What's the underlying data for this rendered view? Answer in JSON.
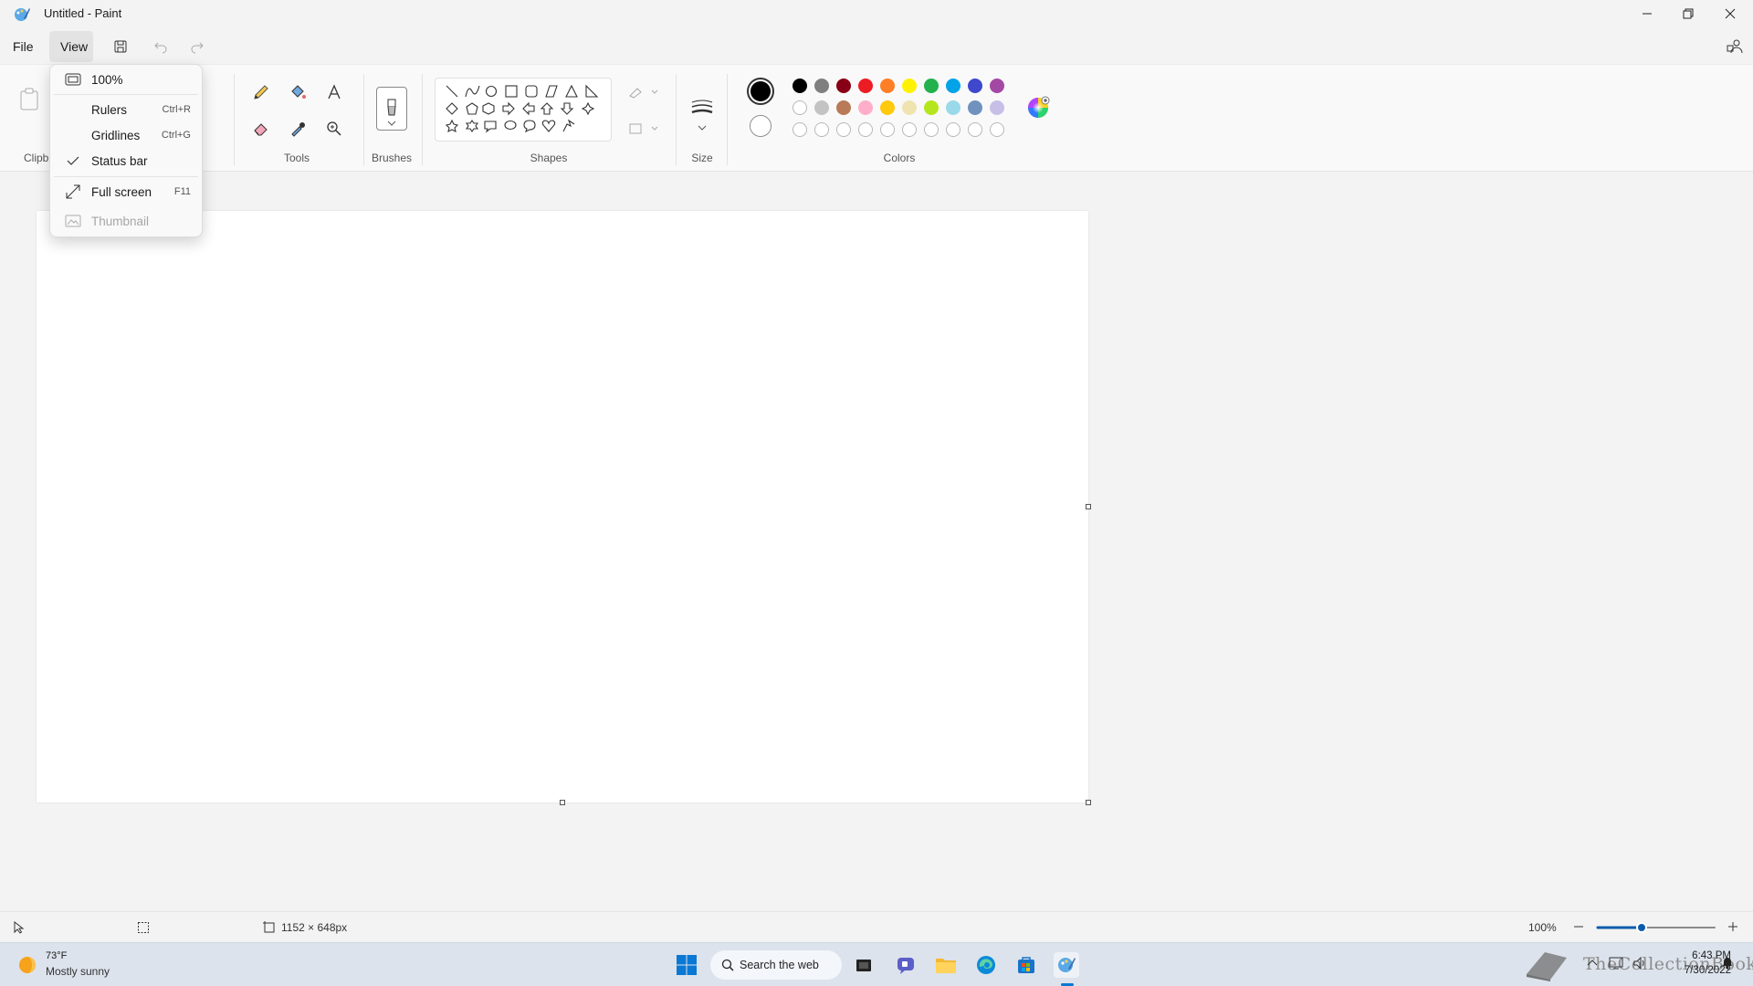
{
  "window": {
    "title": "Untitled - Paint"
  },
  "menu": {
    "file": "File",
    "view": "View"
  },
  "view_menu": {
    "zoom_label": "100%",
    "rulers": "Rulers",
    "rulers_shortcut": "Ctrl+R",
    "gridlines": "Gridlines",
    "gridlines_shortcut": "Ctrl+G",
    "status_bar": "Status bar",
    "status_bar_checked": true,
    "full_screen": "Full screen",
    "full_screen_shortcut": "F11",
    "thumbnail": "Thumbnail",
    "thumbnail_disabled": true
  },
  "ribbon": {
    "clipboard_partial": "Clipb",
    "tools": "Tools",
    "brushes": "Brushes",
    "shapes": "Shapes",
    "size": "Size",
    "colors": "Colors"
  },
  "palette": {
    "primary": "#000000",
    "secondary": "#ffffff",
    "row1": [
      "#000000",
      "#7f7f7f",
      "#880015",
      "#ed1c24",
      "#ff7f27",
      "#fff200",
      "#22b14c",
      "#00a2e8",
      "#3f48cc",
      "#a349a4"
    ],
    "row2": [
      "#ffffff",
      "#c3c3c3",
      "#b97a57",
      "#ffaec9",
      "#ffc90e",
      "#efe4b0",
      "#b5e61d",
      "#99d9ea",
      "#7092be",
      "#c8bfe7"
    ]
  },
  "status": {
    "canvas_size": "1152 × 648px",
    "zoom": "100%"
  },
  "taskbar": {
    "temp": "73°F",
    "weather": "Mostly sunny",
    "search": "Search the web",
    "time": "6:43 PM",
    "date": "7/30/2022",
    "watermark": "TheCollectionBook"
  }
}
